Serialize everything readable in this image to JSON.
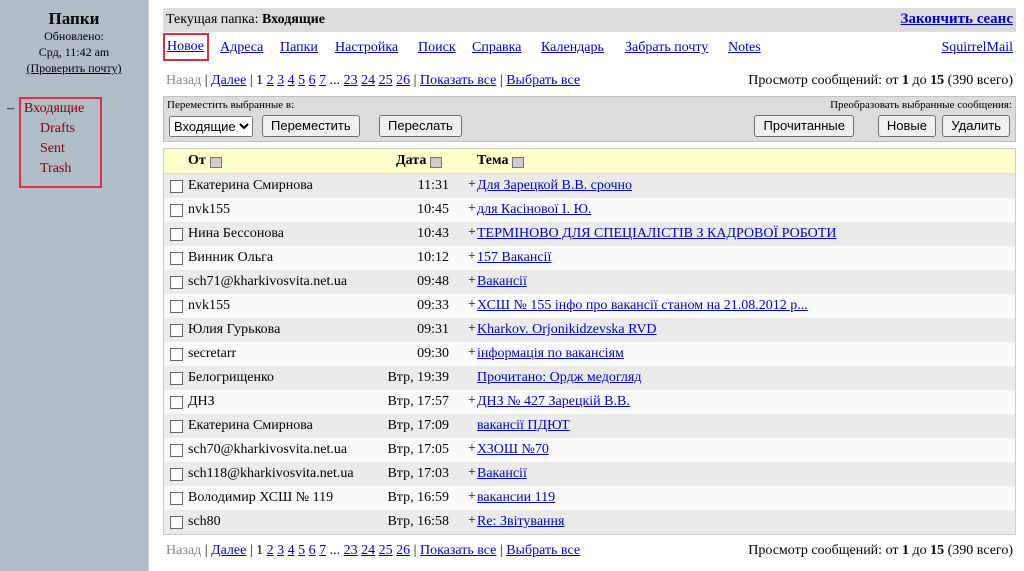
{
  "left": {
    "title": "Папки",
    "updated_label": "Обновлено:",
    "updated_time": "Срд, 11:42 am",
    "check_mail": "(Проверить почту)",
    "folders": [
      "Входящие",
      "Drafts",
      "Sent",
      "Trash"
    ],
    "dash": "–"
  },
  "top": {
    "current_folder_label": "Текущая папка:",
    "current_folder": "Входящие",
    "logout": "Закончить сеанс"
  },
  "menu": {
    "new": "Новое",
    "addresses": "Адреса",
    "folders": "Папки",
    "settings": "Настройка",
    "search": "Поиск",
    "help": "Справка",
    "calendar": "Календарь",
    "fetch": "Забрать почту",
    "notes": "Notes",
    "brand": "SquirrelMail"
  },
  "pager": {
    "prev": "Назад",
    "next": "Далее",
    "pages_before": [
      "1",
      "2",
      "3",
      "4",
      "5",
      "6",
      "7"
    ],
    "ellipsis": "...",
    "pages_after": [
      "23",
      "24",
      "25",
      "26"
    ],
    "show_all": "Показать все",
    "select_all": "Выбрать все",
    "view_label": "Просмотр сообщений: от",
    "from": "1",
    "to_label": "до",
    "to": "15",
    "total": "(390 всего)"
  },
  "controls": {
    "move_label": "Переместить выбранные в:",
    "folder_select": "Входящие",
    "move_btn": "Переместить",
    "forward_btn": "Переслать",
    "transform_label": "Преобразовать выбранные сообщения:",
    "read_btn": "Прочитанные",
    "new_btn": "Новые",
    "delete_btn": "Удалить"
  },
  "columns": {
    "from": "От",
    "date": "Дата",
    "subject": "Тема"
  },
  "messages": [
    {
      "from": "Екатерина Смирнова",
      "date": "11:31",
      "plus": "+",
      "subject": "Для Зарецкой В.В. срочно"
    },
    {
      "from": "nvk155",
      "date": "10:45",
      "plus": "+",
      "subject": "для Касінової І. Ю."
    },
    {
      "from": "Нина Бессонова",
      "date": "10:43",
      "plus": "+",
      "subject": "ТЕРМІНОВО ДЛЯ СПЕЦІАЛІСТІВ З КАДРОВОЇ РОБОТИ"
    },
    {
      "from": "Винник Ольга",
      "date": "10:12",
      "plus": "+",
      "subject": "157    Вакансії"
    },
    {
      "from": "sch71@kharkivosvita.net.ua",
      "date": "09:48",
      "plus": "+",
      "subject": "Вакансії"
    },
    {
      "from": "nvk155",
      "date": "09:33",
      "plus": "+",
      "subject": "ХСШ № 155 інфо про вакансії станом на 21.08.2012 р..."
    },
    {
      "from": "Юлия Гурькова",
      "date": "09:31",
      "plus": "+",
      "subject": "Kharkov. Orjonikidzevska RVD"
    },
    {
      "from": "secretarr",
      "date": "09:30",
      "plus": "+",
      "subject": "інформація по вакансіям"
    },
    {
      "from": "Белогрищенко",
      "date": "Втр, 19:39",
      "plus": "",
      "subject": "Прочитано: Ордж  медогляд"
    },
    {
      "from": "ДНЗ",
      "date": "Втр, 17:57",
      "plus": "+",
      "subject": "ДНЗ № 427 Зарецкій В.В."
    },
    {
      "from": "Екатерина Смирнова",
      "date": "Втр, 17:09",
      "plus": "",
      "subject": "вакансії ПДЮТ"
    },
    {
      "from": "sch70@kharkivosvita.net.ua",
      "date": "Втр, 17:05",
      "plus": "+",
      "subject": "ХЗОШ №70"
    },
    {
      "from": "sch118@kharkivosvita.net.ua",
      "date": "Втр, 17:03",
      "plus": "+",
      "subject": "Вакансії"
    },
    {
      "from": "Володимир ХСШ № 119",
      "date": "Втр, 16:59",
      "plus": "+",
      "subject": "вакансии 119"
    },
    {
      "from": "sch80",
      "date": "Втр, 16:58",
      "plus": "+",
      "subject": "Re: Звітування"
    }
  ]
}
